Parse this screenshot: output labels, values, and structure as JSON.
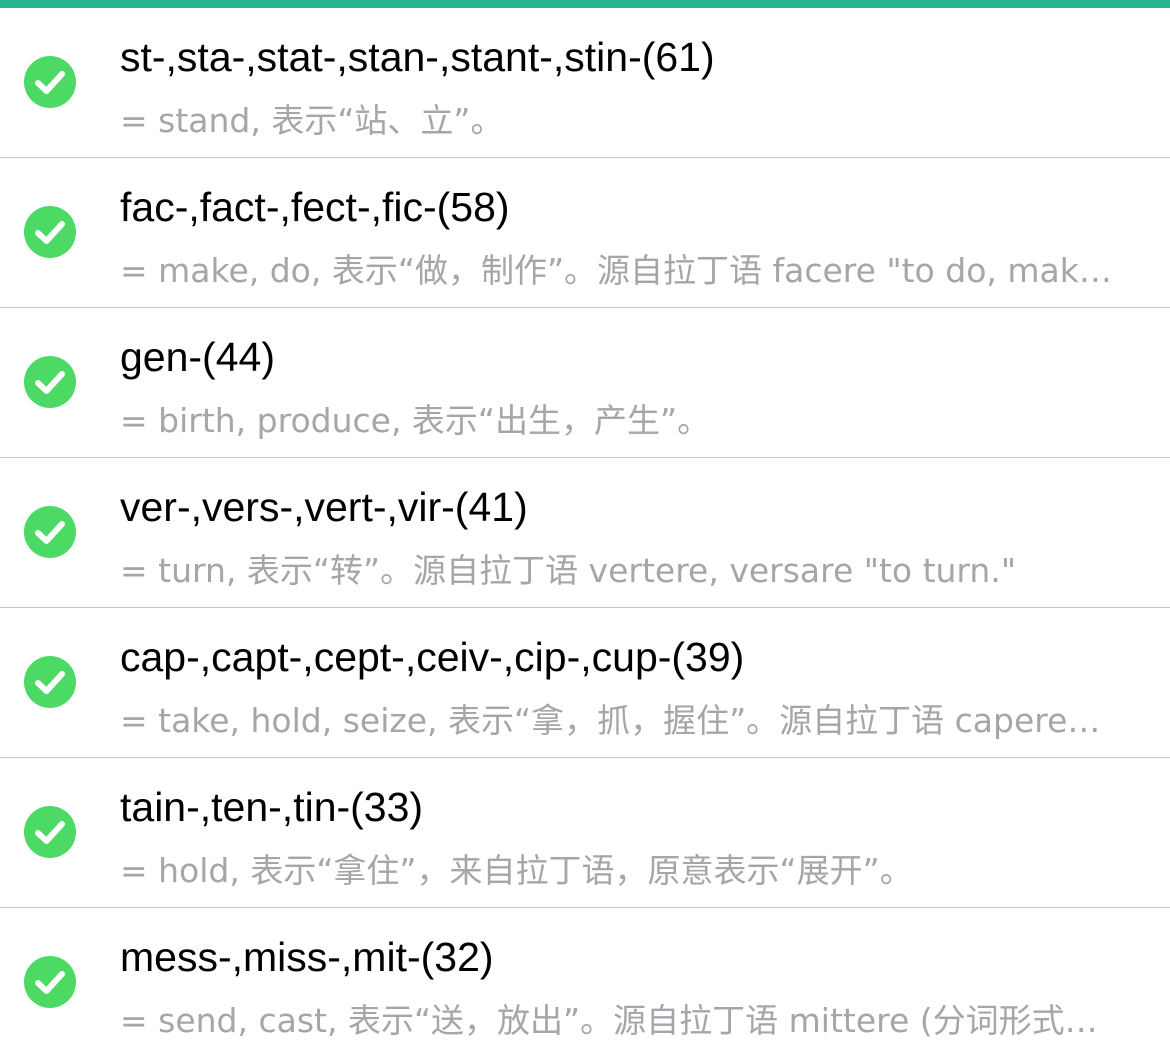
{
  "colors": {
    "accent_bar": "#2bb58f",
    "check": "#4cd964",
    "title": "#000000",
    "subtitle": "#a5a5aa",
    "separator": "#c8c8cc"
  },
  "items": [
    {
      "icon": "check-circle-icon",
      "title": "st-,sta-,stat-,stan-,stant-,stin-(61)",
      "subtitle": "= stand, 表示“站、立”。"
    },
    {
      "icon": "check-circle-icon",
      "title": "fac-,fact-,fect-,fic-(58)",
      "subtitle": "= make, do, 表示“做，制作”。源自拉丁语 facere \"to do, mak…"
    },
    {
      "icon": "check-circle-icon",
      "title": "gen-(44)",
      "subtitle": "= birth, produce, 表示“出生，产生”。"
    },
    {
      "icon": "check-circle-icon",
      "title": "ver-,vers-,vert-,vir-(41)",
      "subtitle": "= turn, 表示“转”。源自拉丁语 vertere, versare \"to turn.\""
    },
    {
      "icon": "check-circle-icon",
      "title": "cap-,capt-,cept-,ceiv-,cip-,cup-(39)",
      "subtitle": "= take, hold, seize, 表示“拿，抓，握住”。源自拉丁语 capere…"
    },
    {
      "icon": "check-circle-icon",
      "title": "tain-,ten-,tin-(33)",
      "subtitle": "= hold, 表示“拿住”，来自拉丁语，原意表示“展开”。"
    },
    {
      "icon": "check-circle-icon",
      "title": "mess-,miss-,mit-(32)",
      "subtitle": "= send, cast, 表示“送，放出”。源自拉丁语 mittere (分词形式…"
    }
  ]
}
